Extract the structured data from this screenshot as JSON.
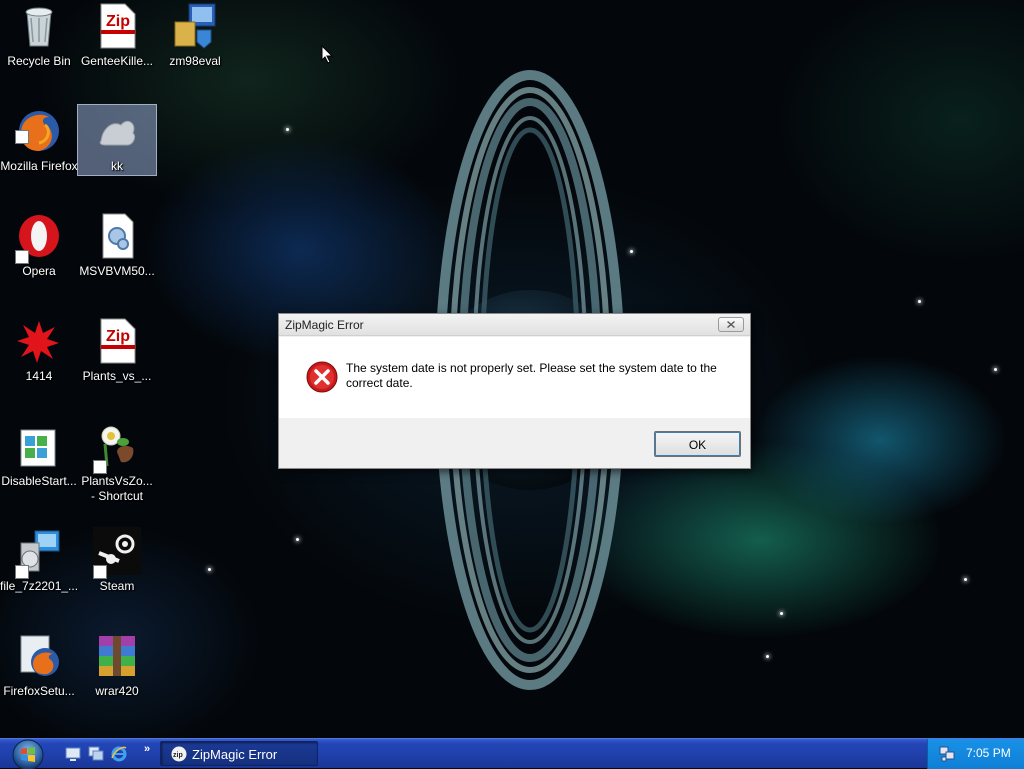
{
  "desktop": {
    "icons": [
      {
        "label": "Recycle Bin",
        "icon": "recycle-bin-icon"
      },
      {
        "label": "GenteeKille...",
        "icon": "zip-file-icon"
      },
      {
        "label": "zm98eval",
        "icon": "installer-icon"
      },
      {
        "label": "Mozilla Firefox",
        "icon": "firefox-icon"
      },
      {
        "label": "kk",
        "icon": "generic-image-icon"
      },
      {
        "label": "Opera",
        "icon": "opera-icon"
      },
      {
        "label": "MSVBVM50...",
        "icon": "dll-file-icon"
      },
      {
        "label": "1414",
        "icon": "red-splat-icon"
      },
      {
        "label": "Plants_vs_...",
        "icon": "zip-file-icon"
      },
      {
        "label": "DisableStart...",
        "icon": "registry-file-icon"
      },
      {
        "label": "PlantsVsZo... - Shortcut",
        "icon": "plants-vs-zombies-icon"
      },
      {
        "label": "file_7z2201_...",
        "icon": "setup-package-icon"
      },
      {
        "label": "Steam",
        "icon": "steam-icon"
      },
      {
        "label": "FirefoxSetu...",
        "icon": "firefox-setup-icon"
      },
      {
        "label": "wrar420",
        "icon": "winrar-icon"
      }
    ]
  },
  "dialog": {
    "title": "ZipMagic Error",
    "message": "The system date is not properly set.  Please set the system date to the correct date.",
    "icon": "error-icon",
    "ok_label": "OK"
  },
  "taskbar": {
    "start_icon": "windows-start-icon",
    "quick_launch": [
      "show-desktop-icon",
      "switch-windows-icon",
      "internet-explorer-icon"
    ],
    "chevron": "»",
    "task_label": "ZipMagic Error",
    "clock": "7:05 PM"
  }
}
